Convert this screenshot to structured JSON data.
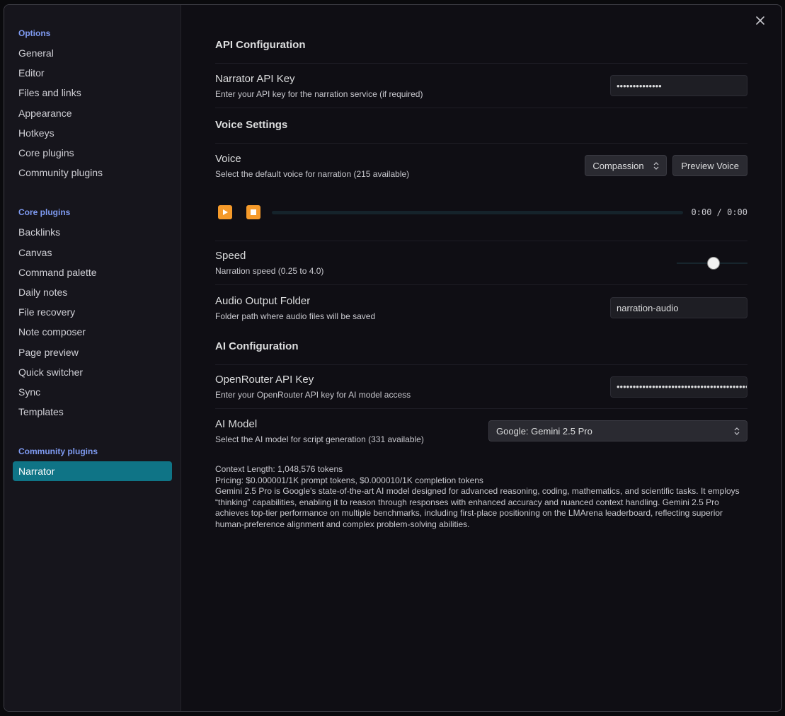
{
  "sidebar": {
    "sections": [
      {
        "heading": "Options",
        "items": [
          "General",
          "Editor",
          "Files and links",
          "Appearance",
          "Hotkeys",
          "Core plugins",
          "Community plugins"
        ]
      },
      {
        "heading": "Core plugins",
        "items": [
          "Backlinks",
          "Canvas",
          "Command palette",
          "Daily notes",
          "File recovery",
          "Note composer",
          "Page preview",
          "Quick switcher",
          "Sync",
          "Templates"
        ]
      },
      {
        "heading": "Community plugins",
        "items": [
          "Narrator"
        ]
      }
    ],
    "active_item": "Narrator"
  },
  "api_config": {
    "heading": "API Configuration",
    "narrator_key": {
      "name": "Narrator API Key",
      "desc": "Enter your API key for the narration service (if required)",
      "value": "••••••••••••••"
    }
  },
  "voice_settings": {
    "heading": "Voice Settings",
    "voice": {
      "name": "Voice",
      "desc": "Select the default voice for narration (215 available)",
      "selected": "Compassion",
      "preview_label": "Preview Voice"
    },
    "player": {
      "play_icon": "play-icon",
      "stop_icon": "stop-icon",
      "time": "0:00 / 0:00",
      "progress": 0
    },
    "speed": {
      "name": "Speed",
      "desc": "Narration speed (0.25 to 4.0)",
      "value_fraction": 0.53
    },
    "output_folder": {
      "name": "Audio Output Folder",
      "desc": "Folder path where audio files will be saved",
      "value": "narration-audio"
    }
  },
  "ai_config": {
    "heading": "AI Configuration",
    "openrouter_key": {
      "name": "OpenRouter API Key",
      "desc": "Enter your OpenRouter API key for AI model access",
      "value": "•••••••••••••••••••••••••••••••••••••••••••••••••••••••••••••••••••••••"
    },
    "model": {
      "name": "AI Model",
      "desc": "Select the AI model for script generation (331 available)",
      "selected": "Google: Gemini 2.5 Pro"
    },
    "model_info": {
      "context": "Context Length: 1,048,576 tokens",
      "pricing": "Pricing: $0.000001/1K prompt tokens, $0.000010/1K completion tokens",
      "description": "Gemini 2.5 Pro is Google's state-of-the-art AI model designed for advanced reasoning, coding, mathematics, and scientific tasks. It employs “thinking” capabilities, enabling it to reason through responses with enhanced accuracy and nuanced context handling. Gemini 2.5 Pro achieves top-tier performance on multiple benchmarks, including first-place positioning on the LMArena leaderboard, reflecting superior human-preference alignment and complex problem-solving abilities."
    }
  },
  "colors": {
    "accent_active": "#0f7486",
    "heading_blue": "#7f9bf2",
    "player_button": "#f59a2a"
  }
}
